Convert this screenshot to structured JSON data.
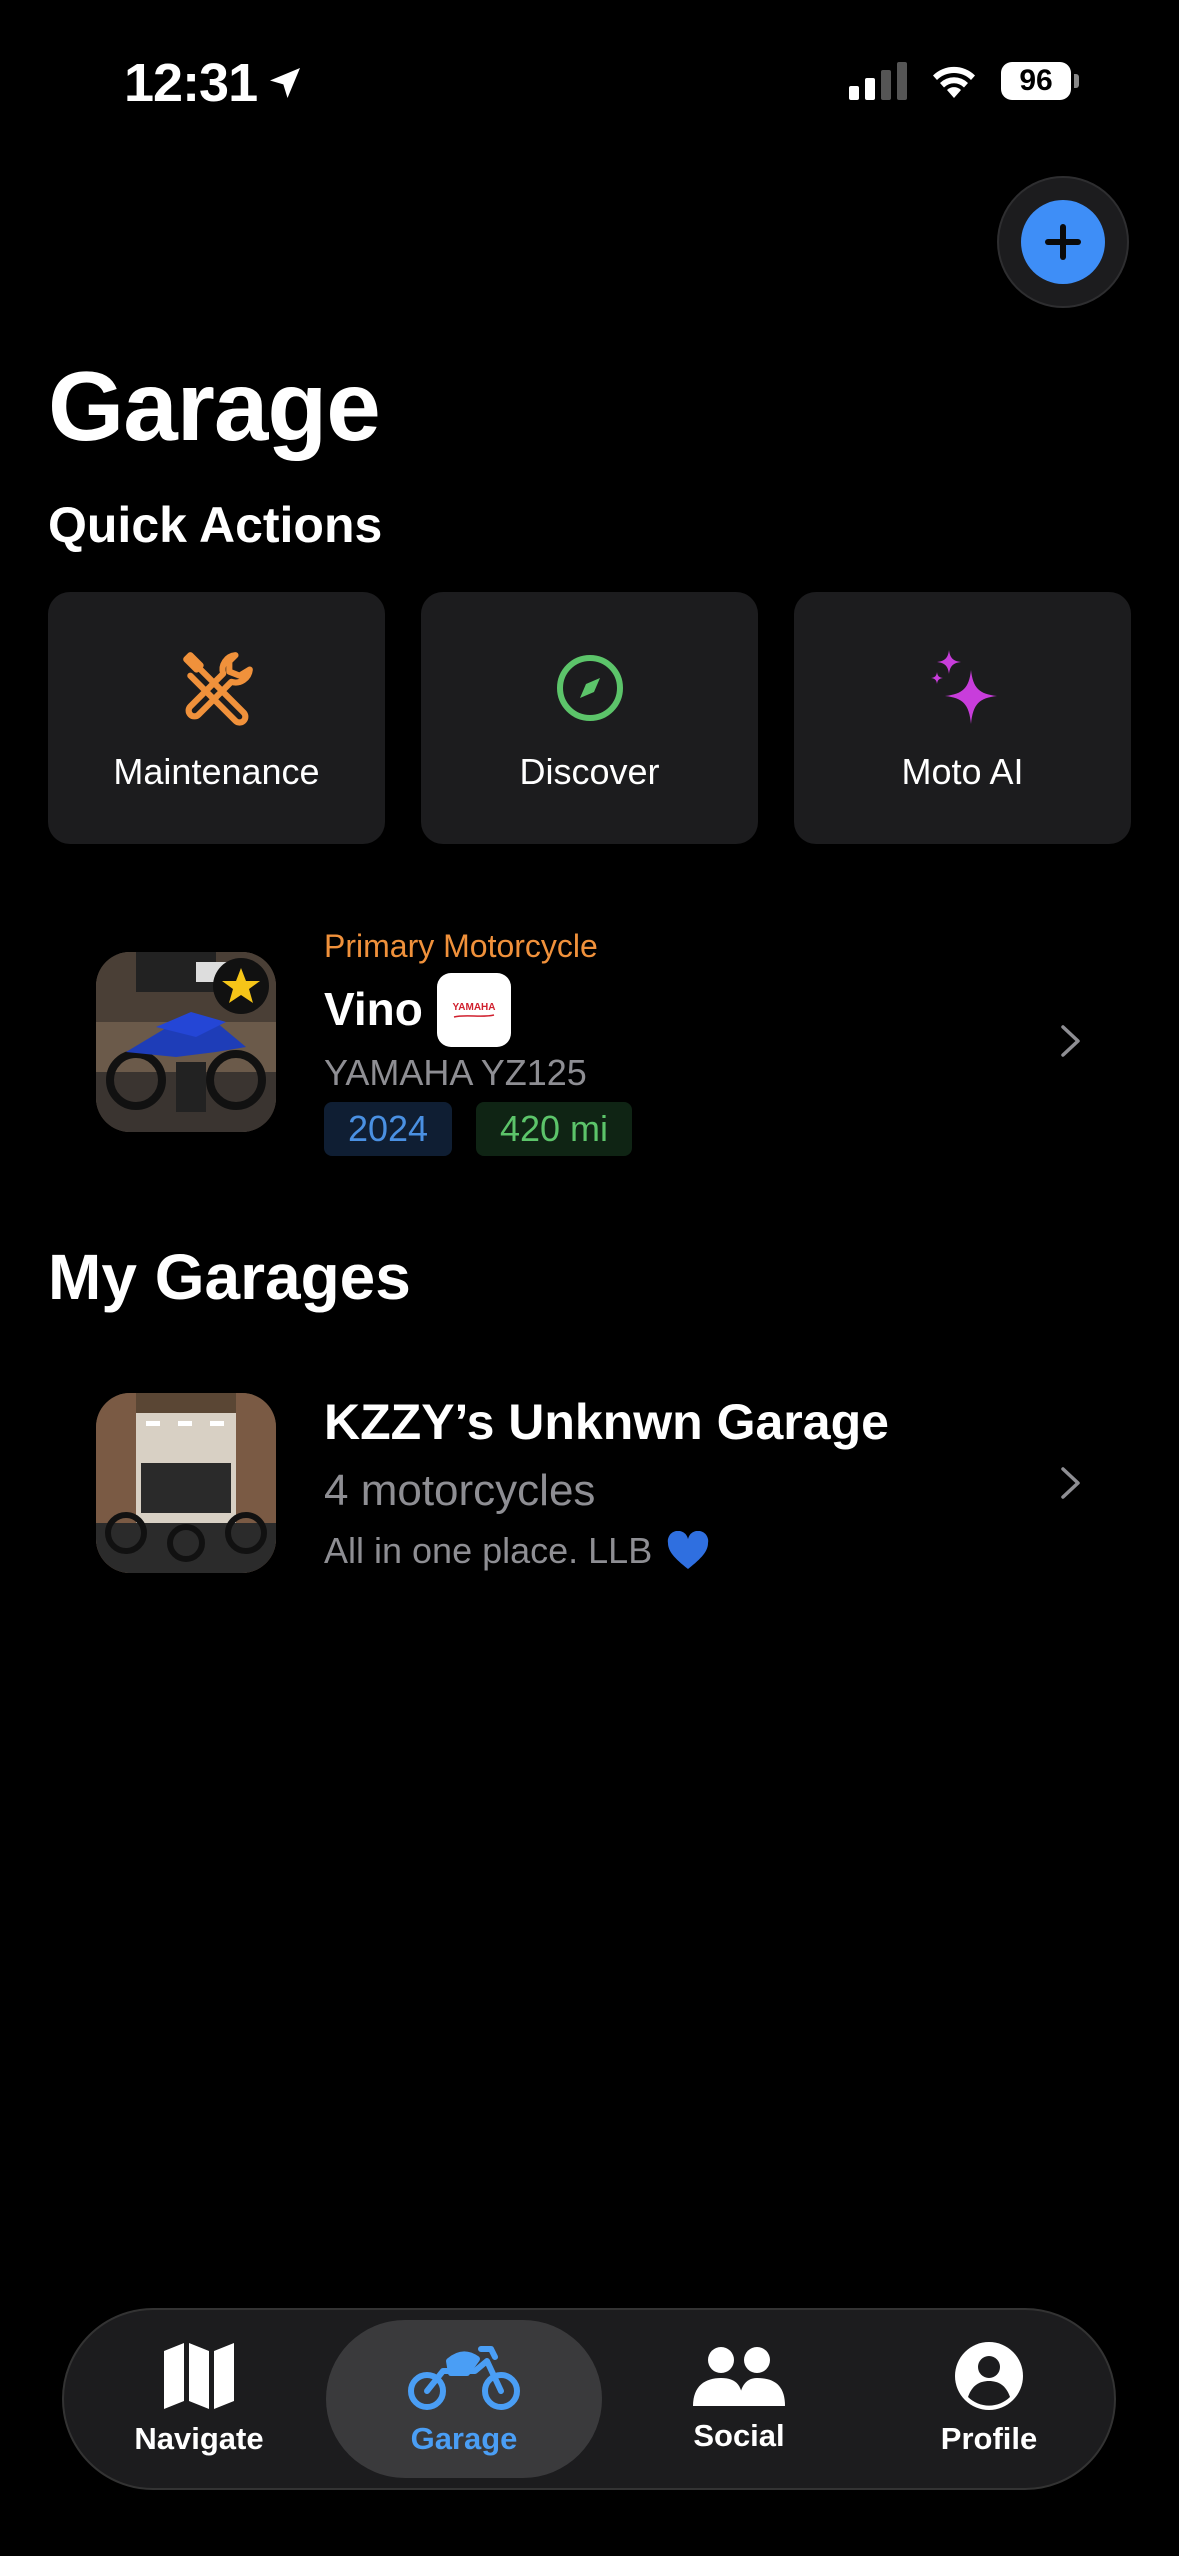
{
  "status_bar": {
    "time": "12:31",
    "battery": "96"
  },
  "header": {
    "title": "Garage",
    "add_button_icon": "plus-icon"
  },
  "quick_actions": {
    "title": "Quick Actions",
    "items": [
      {
        "label": "Maintenance",
        "icon": "wrench-screwdriver-icon",
        "color": "#f0913b"
      },
      {
        "label": "Discover",
        "icon": "compass-icon",
        "color": "#5cc46a"
      },
      {
        "label": "Moto AI",
        "icon": "sparkles-icon",
        "color": "#c83ddb"
      }
    ]
  },
  "primary_motorcycle": {
    "label": "Primary Motorcycle",
    "name": "Vino",
    "brand_logo_text": "YAMAHA",
    "model": "YAMAHA YZ125",
    "year": "2024",
    "mileage": "420 mi"
  },
  "my_garages": {
    "title": "My Garages",
    "items": [
      {
        "name": "KZZY’s Unknwn Garage",
        "count": "4 motorcycles",
        "description": "All in one place. LLB",
        "emoji": "💙"
      }
    ]
  },
  "tab_bar": {
    "tabs": [
      {
        "label": "Navigate",
        "icon": "map-icon",
        "active": false
      },
      {
        "label": "Garage",
        "icon": "motorcycle-icon",
        "active": true
      },
      {
        "label": "Social",
        "icon": "people-icon",
        "active": false
      },
      {
        "label": "Profile",
        "icon": "person-circle-icon",
        "active": false
      }
    ],
    "active_color": "#4a9ef5"
  }
}
